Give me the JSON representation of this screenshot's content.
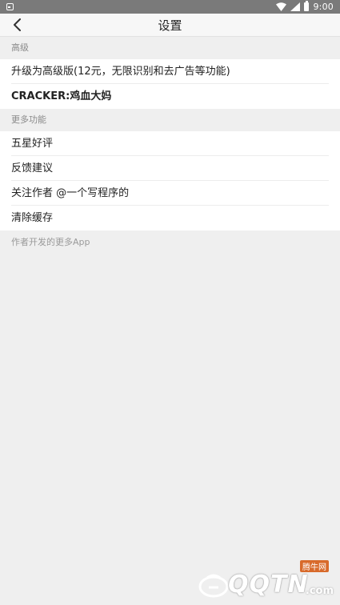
{
  "status_bar": {
    "time": "9:00"
  },
  "header": {
    "title": "设置"
  },
  "sections": [
    {
      "label": "高级",
      "items": [
        {
          "label": "升级为高级版(12元，无限识别和去广告等功能)"
        },
        {
          "label": "CRACKER:鸡血大妈"
        }
      ]
    },
    {
      "label": "更多功能",
      "items": [
        {
          "label": "五星好评"
        },
        {
          "label": "反馈建议"
        },
        {
          "label": "关注作者 @一个写程序的"
        },
        {
          "label": "清除缓存"
        }
      ]
    }
  ],
  "footer": {
    "more_apps_label": "作者开发的更多App"
  },
  "watermark": {
    "brand": "QQTN",
    "domain": ".com",
    "badge": "腾牛网"
  },
  "colors": {
    "status_bar": "#7a7a7a",
    "background": "#efefef",
    "row": "#ffffff"
  }
}
